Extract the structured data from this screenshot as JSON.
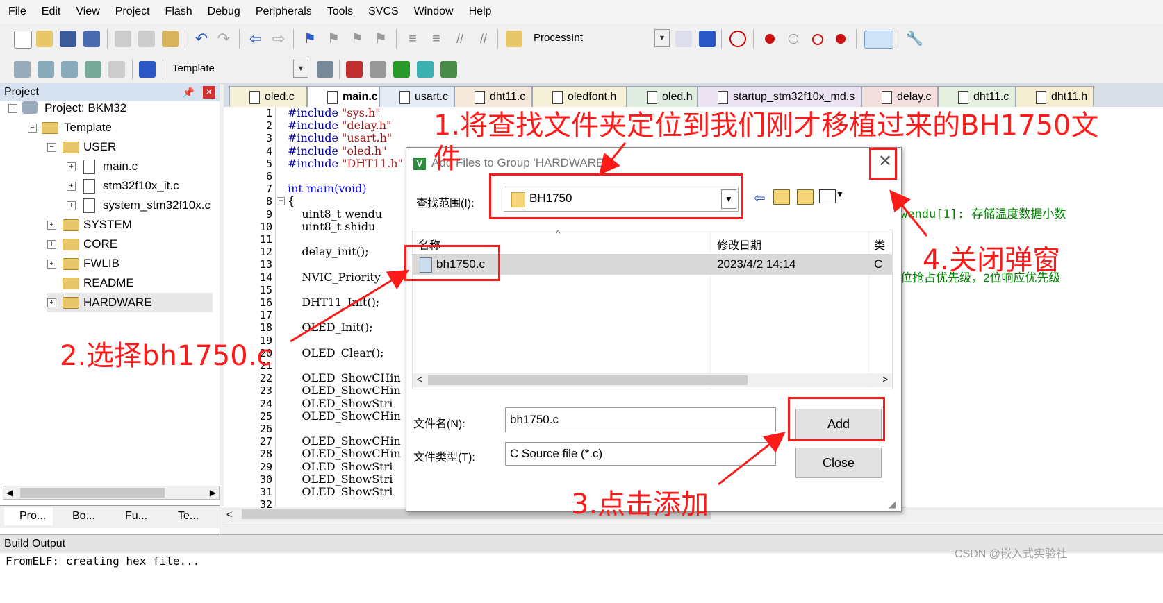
{
  "menubar": [
    "File",
    "Edit",
    "View",
    "Project",
    "Flash",
    "Debug",
    "Peripherals",
    "Tools",
    "SVCS",
    "Window",
    "Help"
  ],
  "toolbar1": {
    "target_combo": "ProcessInt"
  },
  "toolbar2": {
    "target_select": "Template"
  },
  "project_panel": {
    "title": "Project",
    "root": "Project: BKM32",
    "target": "Template",
    "groups": [
      "USER",
      "SYSTEM",
      "CORE",
      "FWLIB",
      "README",
      "HARDWARE"
    ],
    "user_files": [
      "main.c",
      "stm32f10x_it.c",
      "system_stm32f10x.c"
    ],
    "bottom_tabs": [
      "Pro...",
      "Bo...",
      "Fu...",
      "Te..."
    ]
  },
  "tabs": [
    "oled.c",
    "main.c",
    "usart.c",
    "dht11.c",
    "oledfont.h",
    "oled.h",
    "startup_stm32f10x_md.s",
    "delay.c",
    "dht11.c",
    "dht11.h"
  ],
  "code_lines": [
    {
      "n": "1",
      "t": "#include \"sys.h\""
    },
    {
      "n": "2",
      "t": "#include \"delay.h\""
    },
    {
      "n": "3",
      "t": "#include \"usart.h\""
    },
    {
      "n": "4",
      "t": "#include \"oled.h\""
    },
    {
      "n": "5",
      "t": "#include \"DHT11.h\""
    },
    {
      "n": "6",
      "t": ""
    },
    {
      "n": "7",
      "t": "int main(void)"
    },
    {
      "n": "8",
      "t": "{"
    },
    {
      "n": "9",
      "t": "    uint8_t wendu"
    },
    {
      "n": "10",
      "t": "    uint8_t shidu"
    },
    {
      "n": "11",
      "t": ""
    },
    {
      "n": "12",
      "t": "    delay_init();"
    },
    {
      "n": "13",
      "t": ""
    },
    {
      "n": "14",
      "t": "    NVIC_Priority"
    },
    {
      "n": "15",
      "t": ""
    },
    {
      "n": "16",
      "t": "    DHT11_Init();"
    },
    {
      "n": "17",
      "t": ""
    },
    {
      "n": "18",
      "t": "    OLED_Init();"
    },
    {
      "n": "19",
      "t": ""
    },
    {
      "n": "20",
      "t": "    OLED_Clear();"
    },
    {
      "n": "21",
      "t": ""
    },
    {
      "n": "22",
      "t": "    OLED_ShowCHin"
    },
    {
      "n": "23",
      "t": "    OLED_ShowCHin"
    },
    {
      "n": "24",
      "t": "    OLED_ShowStri"
    },
    {
      "n": "25",
      "t": "    OLED_ShowCHin"
    },
    {
      "n": "26",
      "t": ""
    },
    {
      "n": "27",
      "t": "    OLED_ShowCHin"
    },
    {
      "n": "28",
      "t": "    OLED_ShowCHin"
    },
    {
      "n": "29",
      "t": "    OLED_ShowStri"
    },
    {
      "n": "30",
      "t": "    OLED_ShowStri"
    },
    {
      "n": "31",
      "t": "    OLED_ShowStri"
    },
    {
      "n": "32",
      "t": ""
    }
  ],
  "comments": {
    "line9": "wendu[1]: 存储温度数据小数",
    "line14": "位抢占优先级，2位响应优先级"
  },
  "dialog": {
    "title": "Add Files to Group 'HARDWARE'",
    "lookin_label": "查找范围(I):",
    "lookin_value": "BH1750",
    "col_name": "名称",
    "col_date": "修改日期",
    "col_type": "类",
    "file_name": "bh1750.c",
    "file_date": "2023/4/2 14:14",
    "file_type": "C",
    "filename_label": "文件名(N):",
    "filename_value": "bh1750.c",
    "filetype_label": "文件类型(T):",
    "filetype_value": "C Source file (*.c)",
    "add_button": "Add",
    "close_button": "Close"
  },
  "annotations": {
    "step1": "1.将查找文件夹定位到我们刚才移植过来的BH1750文",
    "step1b": "件",
    "step2": "2.选择bh1750.c",
    "step3": "3.点击添加",
    "step4": "4.关闭弹窗"
  },
  "build_output": {
    "title": "Build Output",
    "line": "FromELF: creating hex file..."
  },
  "watermark": "CSDN @嵌入式实验社",
  "colors": {
    "annotation": "#ff1a1a",
    "keyword": "#0000ff",
    "string": "#a31515",
    "comment": "#008000"
  }
}
